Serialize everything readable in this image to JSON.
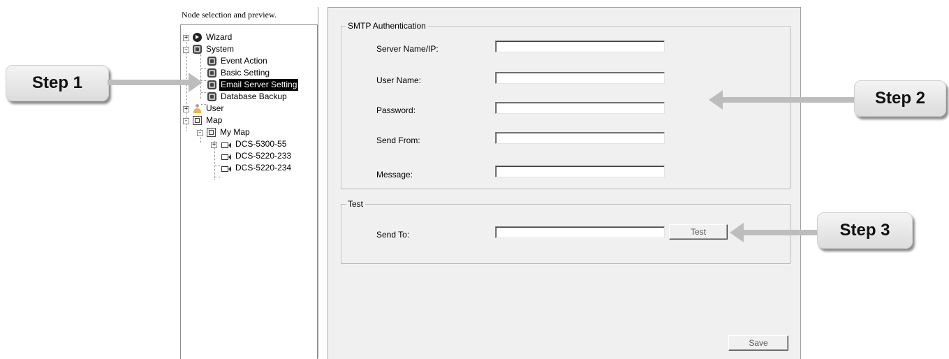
{
  "tree": {
    "header": "Node selection and preview.",
    "nodes": [
      {
        "label": "Wizard",
        "icon": "wizard-icon",
        "expander": "+"
      },
      {
        "label": "System",
        "icon": "gear-icon",
        "expander": "-"
      },
      {
        "label": "Event Action",
        "icon": "gear-icon"
      },
      {
        "label": "Basic Setting",
        "icon": "gear-icon"
      },
      {
        "label": "Email Server Setting",
        "icon": "gear-icon",
        "selected": true
      },
      {
        "label": "Database Backup",
        "icon": "gear-icon"
      },
      {
        "label": "User",
        "icon": "user-icon",
        "expander": "+"
      },
      {
        "label": "Map",
        "icon": "map-icon",
        "expander": "-"
      },
      {
        "label": "My Map",
        "icon": "map-icon",
        "expander": "-"
      },
      {
        "label": "DCS-5300-55",
        "icon": "camera-icon",
        "expander": "+"
      },
      {
        "label": "DCS-5220-233",
        "icon": "camera-icon"
      },
      {
        "label": "DCS-5220-234",
        "icon": "camera-icon"
      }
    ]
  },
  "smtp": {
    "legend": "SMTP Authentication",
    "server_label": "Server Name/IP:",
    "server_value": "",
    "user_label": "User Name:",
    "user_value": "",
    "password_label": "Password:",
    "password_value": "",
    "from_label": "Send From:",
    "from_value": "",
    "message_label": "Message:",
    "message_value": ""
  },
  "test": {
    "legend": "Test",
    "sendto_label": "Send To:",
    "sendto_value": "",
    "button_label": "Test"
  },
  "save_label": "Save",
  "steps": {
    "step1": "Step 1",
    "step2": "Step 2",
    "step3": "Step 3"
  },
  "colors": {
    "panel_bg": "#f0f0f0",
    "selection_bg": "#000000",
    "arrow": "#bdbdbd"
  }
}
